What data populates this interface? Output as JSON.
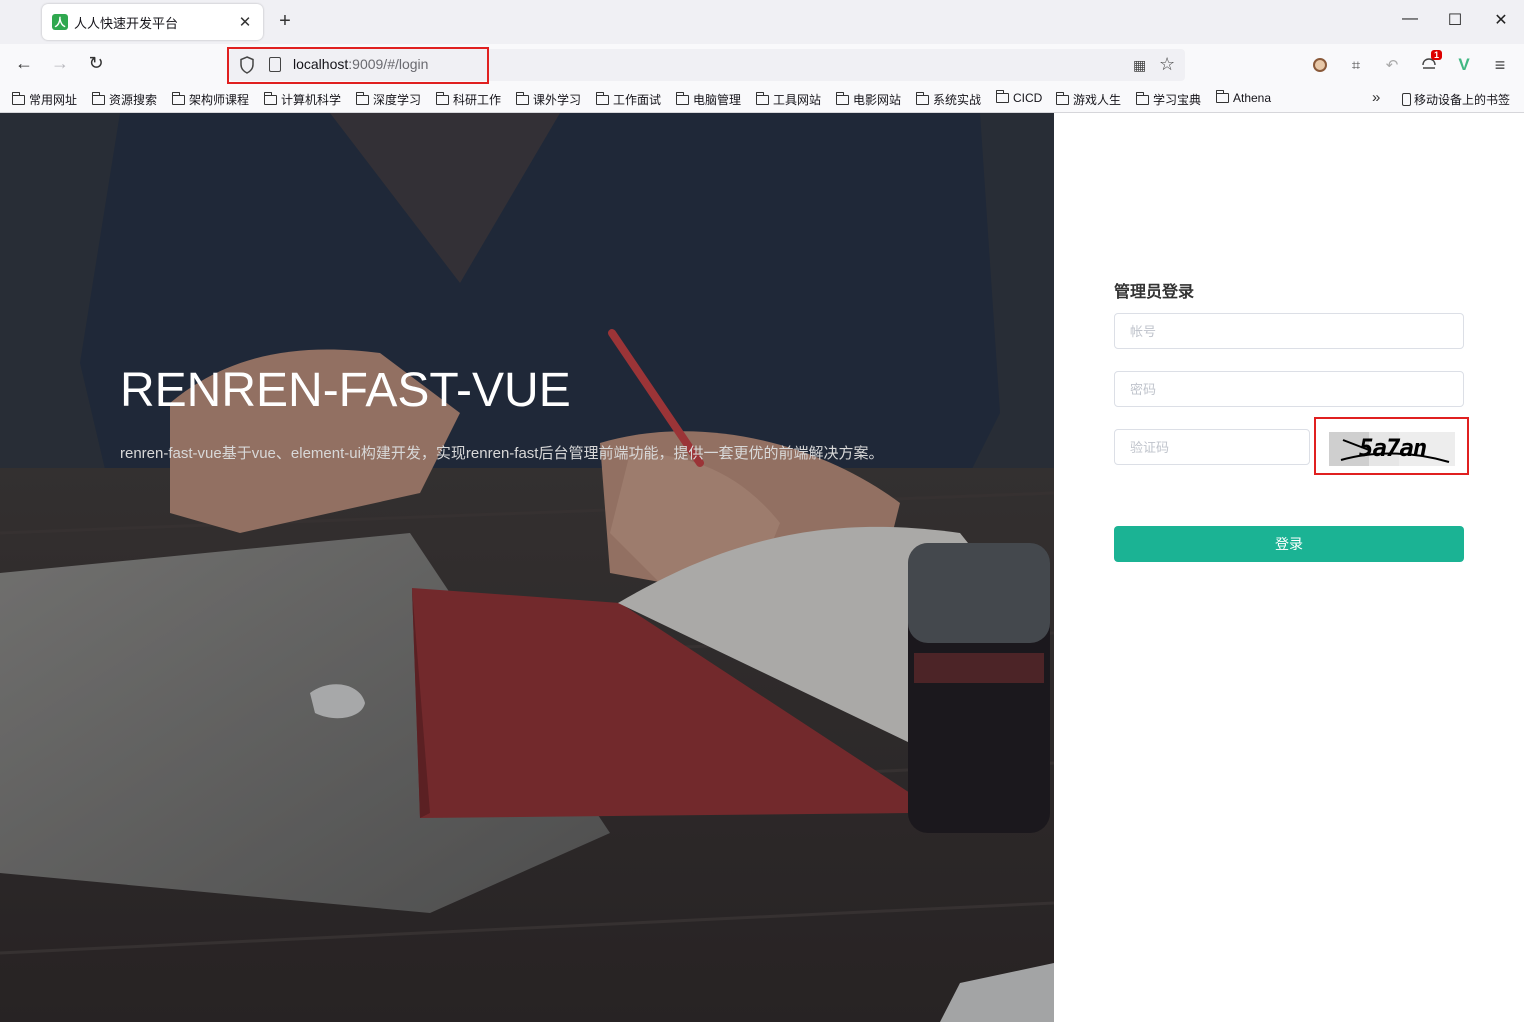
{
  "browser": {
    "tab": {
      "title": "人人快速开发平台",
      "favicon_glyph": "人",
      "favicon_color": "#2fa84f",
      "close_glyph": "✕"
    },
    "new_tab_glyph": "+",
    "window_controls": {
      "minimize": "—",
      "maximize": "☐",
      "close": "✕"
    },
    "nav": {
      "back": "←",
      "forward": "→",
      "reload": "↻"
    },
    "url": {
      "host": "localhost",
      "rest": ":9009/#/login"
    },
    "url_icons": {
      "qr": "▦",
      "bookmark_star": "☆"
    },
    "extensions": {
      "crop": "⌗",
      "undo": "↶",
      "badge_count": "1",
      "vue": "V",
      "menu": "≡"
    },
    "bookmarks": [
      "常用网址",
      "资源搜索",
      "架构师课程",
      "计算机科学",
      "深度学习",
      "科研工作",
      "课外学习",
      "工作面试",
      "电脑管理",
      "工具网站",
      "电影网站",
      "系统实战",
      "CICD",
      "游戏人生",
      "学习宝典",
      "Athena"
    ],
    "bookmarks_more": "»",
    "mobile_bookmarks": "移动设备上的书签"
  },
  "hero": {
    "title": "RENREN-FAST-VUE",
    "description": "renren-fast-vue基于vue、element-ui构建开发，实现renren-fast后台管理前端功能，提供一套更优的前端解决方案。"
  },
  "login": {
    "title": "管理员登录",
    "username_placeholder": "帐号",
    "password_placeholder": "密码",
    "captcha_placeholder": "验证码",
    "captcha_text": "5a7an",
    "submit_label": "登录",
    "accent_color": "#1bb394"
  }
}
